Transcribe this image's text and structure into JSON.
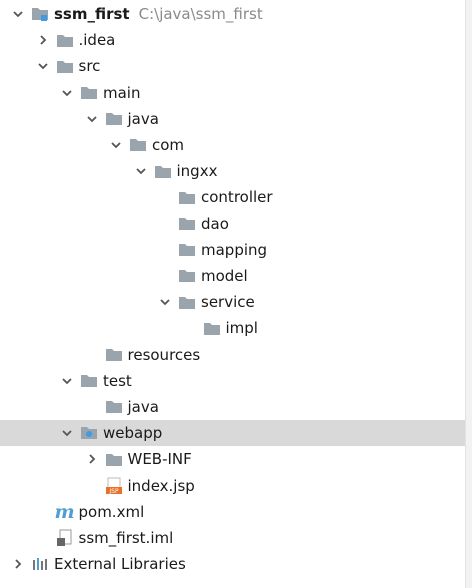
{
  "tree": [
    {
      "label": "ssm_first",
      "path": "C:\\java\\ssm_first",
      "bold": true,
      "indent": 0,
      "toggle": "open",
      "icon": "module-folder-icon"
    },
    {
      "label": ".idea",
      "indent": 1,
      "toggle": "closed",
      "icon": "folder-icon"
    },
    {
      "label": "src",
      "indent": 1,
      "toggle": "open",
      "icon": "folder-icon"
    },
    {
      "label": "main",
      "indent": 2,
      "toggle": "open",
      "icon": "folder-icon"
    },
    {
      "label": "java",
      "indent": 3,
      "toggle": "open",
      "icon": "folder-icon"
    },
    {
      "label": "com",
      "indent": 4,
      "toggle": "open",
      "icon": "folder-icon"
    },
    {
      "label": "ingxx",
      "indent": 5,
      "toggle": "open",
      "icon": "folder-icon"
    },
    {
      "label": "controller",
      "indent": 6,
      "toggle": "none",
      "icon": "folder-icon"
    },
    {
      "label": "dao",
      "indent": 6,
      "toggle": "none",
      "icon": "folder-icon"
    },
    {
      "label": "mapping",
      "indent": 6,
      "toggle": "none",
      "icon": "folder-icon"
    },
    {
      "label": "model",
      "indent": 6,
      "toggle": "none",
      "icon": "folder-icon"
    },
    {
      "label": "service",
      "indent": 6,
      "toggle": "open",
      "icon": "folder-icon"
    },
    {
      "label": "impl",
      "indent": 7,
      "toggle": "none",
      "icon": "folder-icon"
    },
    {
      "label": "resources",
      "indent": 3,
      "toggle": "none",
      "icon": "folder-icon"
    },
    {
      "label": "test",
      "indent": 2,
      "toggle": "open",
      "icon": "folder-icon"
    },
    {
      "label": "java",
      "indent": 3,
      "toggle": "none",
      "icon": "folder-icon"
    },
    {
      "label": "webapp",
      "indent": 2,
      "toggle": "open",
      "icon": "web-folder-icon",
      "selected": true
    },
    {
      "label": "WEB-INF",
      "indent": 3,
      "toggle": "closed",
      "icon": "folder-icon"
    },
    {
      "label": "index.jsp",
      "indent": 3,
      "toggle": "none",
      "icon": "jsp-file-icon"
    },
    {
      "label": "pom.xml",
      "indent": 1,
      "toggle": "none",
      "icon": "maven-icon"
    },
    {
      "label": "ssm_first.iml",
      "indent": 1,
      "toggle": "none",
      "icon": "iml-file-icon"
    },
    {
      "label": "External Libraries",
      "indent": 0,
      "toggle": "closed",
      "icon": "libraries-icon"
    }
  ],
  "icons": {
    "maven_glyph": "m",
    "jsp_badge": "JSP"
  },
  "colors": {
    "folder": "#9aa4ad",
    "selection": "#d9d9d9",
    "web_badge": "#3d9be9",
    "jsp": "#e8702a"
  }
}
